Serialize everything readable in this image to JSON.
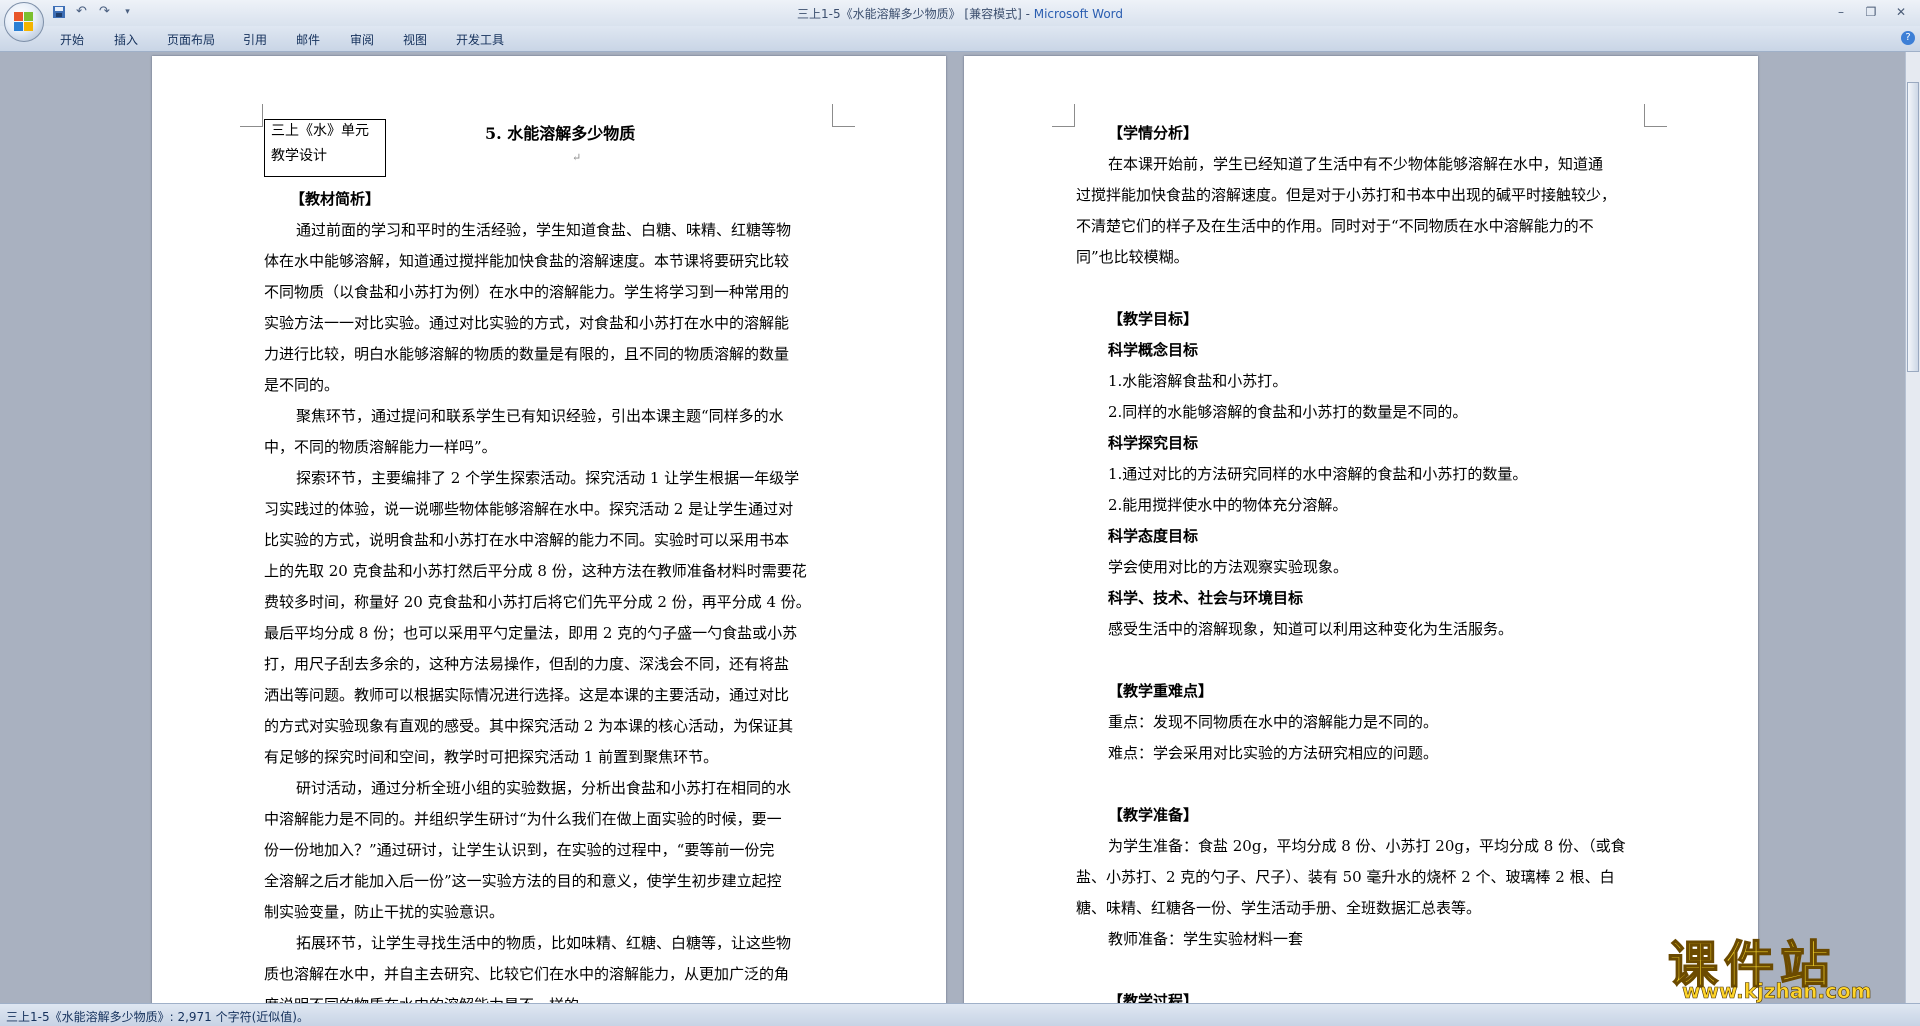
{
  "window": {
    "title": "三上1-5《水能溶解多少物质》 [兼容模式] - ",
    "app_name": "Microsoft Word"
  },
  "quick_access": {
    "icons": [
      "save-icon",
      "undo-icon",
      "redo-icon",
      "customize-icon"
    ]
  },
  "ribbon": {
    "tabs": [
      "开始",
      "插入",
      "页面布局",
      "引用",
      "邮件",
      "审阅",
      "视图",
      "开发工具"
    ]
  },
  "page_left": {
    "header_box": [
      "三上《水》单元",
      "教学设计"
    ],
    "title": "5. 水能溶解多少物质",
    "lines": [
      {
        "text": "【教材简析】",
        "bold": true
      },
      {
        "text": "通过前面的学习和平时的生活经验，学生知道食盐、白糖、味精、红糖等物",
        "bold": false
      },
      {
        "text": "体在水中能够溶解，知道通过搅拌能加快食盐的溶解速度。本节课将要研究比较",
        "bold": false
      },
      {
        "text": "不同物质（以食盐和小苏打为例）在水中的溶解能力。学生将学习到一种常用的",
        "bold": false
      },
      {
        "text": "实验方法一一对比实验。通过对比实验的方式，对食盐和小苏打在水中的溶解能",
        "bold": false
      },
      {
        "text": "力进行比较，明白水能够溶解的物质的数量是有限的，且不同的物质溶解的数量",
        "bold": false
      },
      {
        "text": "是不同的。",
        "bold": false
      },
      {
        "text": "聚焦环节，通过提问和联系学生已有知识经验，引出本课主题“同样多的水",
        "bold": false
      },
      {
        "text": "中，不同的物质溶解能力一样吗”。",
        "bold": false
      },
      {
        "text": "探索环节，主要编排了 2 个学生探索活动。探究活动 1 让学生根据一年级学",
        "bold": false
      },
      {
        "text": "习实践过的体验，说一说哪些物体能够溶解在水中。探究活动 2 是让学生通过对",
        "bold": false
      },
      {
        "text": "比实验的方式，说明食盐和小苏打在水中溶解的能力不同。实验时可以采用书本",
        "bold": false
      },
      {
        "text": "上的先取 20 克食盐和小苏打然后平分成 8 份，这种方法在教师准备材料时需要花",
        "bold": false
      },
      {
        "text": "费较多时间，称量好 20 克食盐和小苏打后将它们先平分成 2 份，再平分成 4 份。",
        "bold": false
      },
      {
        "text": "最后平均分成 8 份；也可以采用平勺定量法，即用 2 克的勺子盛一勺食盐或小苏",
        "bold": false
      },
      {
        "text": "打，用尺子刮去多余的，这种方法易操作，但刮的力度、深浅会不同，还有将盐",
        "bold": false
      },
      {
        "text": "洒出等问题。教师可以根据实际情况进行选择。这是本课的主要活动，通过对比",
        "bold": false
      },
      {
        "text": "的方式对实验现象有直观的感受。其中探究活动 2 为本课的核心活动，为保证其",
        "bold": false
      },
      {
        "text": "有足够的探究时间和空间，教学时可把探究活动 1 前置到聚焦环节。",
        "bold": false
      },
      {
        "text": "研讨活动，通过分析全班小组的实验数据，分析出食盐和小苏打在相同的水",
        "bold": false
      },
      {
        "text": "中溶解能力是不同的。并组织学生研讨“为什么我们在做上面实验的时候，要一",
        "bold": false
      },
      {
        "text": "份一份地加入？”通过研讨，让学生认识到，在实验的过程中，“要等前一份完",
        "bold": false
      },
      {
        "text": "全溶解之后才能加入后一份”这一实验方法的目的和意义，使学生初步建立起控",
        "bold": false
      },
      {
        "text": "制实验变量，防止干扰的实验意识。",
        "bold": false
      },
      {
        "text": "拓展环节，让学生寻找生活中的物质，比如味精、红糖、白糖等，让这些物",
        "bold": false
      },
      {
        "text": "质也溶解在水中，并自主去研究、比较它们在水中的溶解能力，从更加广泛的角",
        "bold": false
      },
      {
        "text": "度说明不同的物质在水中的溶解能力是不一样的。",
        "bold": false
      }
    ]
  },
  "page_right": {
    "lines": [
      {
        "text": "【学情分析】",
        "bold": true
      },
      {
        "text": "在本课开始前，学生已经知道了生活中有不少物体能够溶解在水中，知道通",
        "bold": false
      },
      {
        "text": "过搅拌能加快食盐的溶解速度。但是对于小苏打和书本中出现的碱平时接触较少，",
        "bold": false
      },
      {
        "text": "不清楚它们的样子及在生活中的作用。同时对于“不同物质在水中溶解能力的不",
        "bold": false
      },
      {
        "text": "同”也比较模糊。",
        "bold": false
      },
      {
        "text": "",
        "bold": false
      },
      {
        "text": "【教学目标】",
        "bold": true
      },
      {
        "text": "科学概念目标",
        "bold": true
      },
      {
        "text": "1.水能溶解食盐和小苏打。",
        "bold": false
      },
      {
        "text": "2.同样的水能够溶解的食盐和小苏打的数量是不同的。",
        "bold": false
      },
      {
        "text": "科学探究目标",
        "bold": true
      },
      {
        "text": "1.通过对比的方法研究同样的水中溶解的食盐和小苏打的数量。",
        "bold": false
      },
      {
        "text": "2.能用搅拌使水中的物体充分溶解。",
        "bold": false
      },
      {
        "text": "科学态度目标",
        "bold": true
      },
      {
        "text": "学会使用对比的方法观察实验现象。",
        "bold": false
      },
      {
        "text": "科学、技术、社会与环境目标",
        "bold": true
      },
      {
        "text": "感受生活中的溶解现象，知道可以利用这种变化为生活服务。",
        "bold": false
      },
      {
        "text": "",
        "bold": false
      },
      {
        "text": "【教学重难点】",
        "bold": true
      },
      {
        "text": "重点：发现不同物质在水中的溶解能力是不同的。",
        "bold": false
      },
      {
        "text": "难点：学会采用对比实验的方法研究相应的问题。",
        "bold": false
      },
      {
        "text": "",
        "bold": false
      },
      {
        "text": "【教学准备】",
        "bold": true
      },
      {
        "text": "为学生准备：食盐 20g，平均分成 8 份、小苏打 20g，平均分成 8 份、（或食",
        "bold": false
      },
      {
        "text": "盐、小苏打、2 克的勺子、尺子）、装有 50 毫升水的烧杯 2 个、玻璃棒 2 根、白",
        "bold": false
      },
      {
        "text": "糖、味精、红糖各一份、学生活动手册、全班数据汇总表等。",
        "bold": false
      },
      {
        "text": "教师准备：学生实验材料一套",
        "bold": false
      },
      {
        "text": "",
        "bold": false
      },
      {
        "text": "【教学过程】",
        "bold": true
      }
    ]
  },
  "status": {
    "text": "三上1-5《水能溶解多少物质》: 2,971 个字符(近似值)。"
  },
  "watermark": {
    "title": "课件站",
    "url": "www.kjzhan.com"
  }
}
